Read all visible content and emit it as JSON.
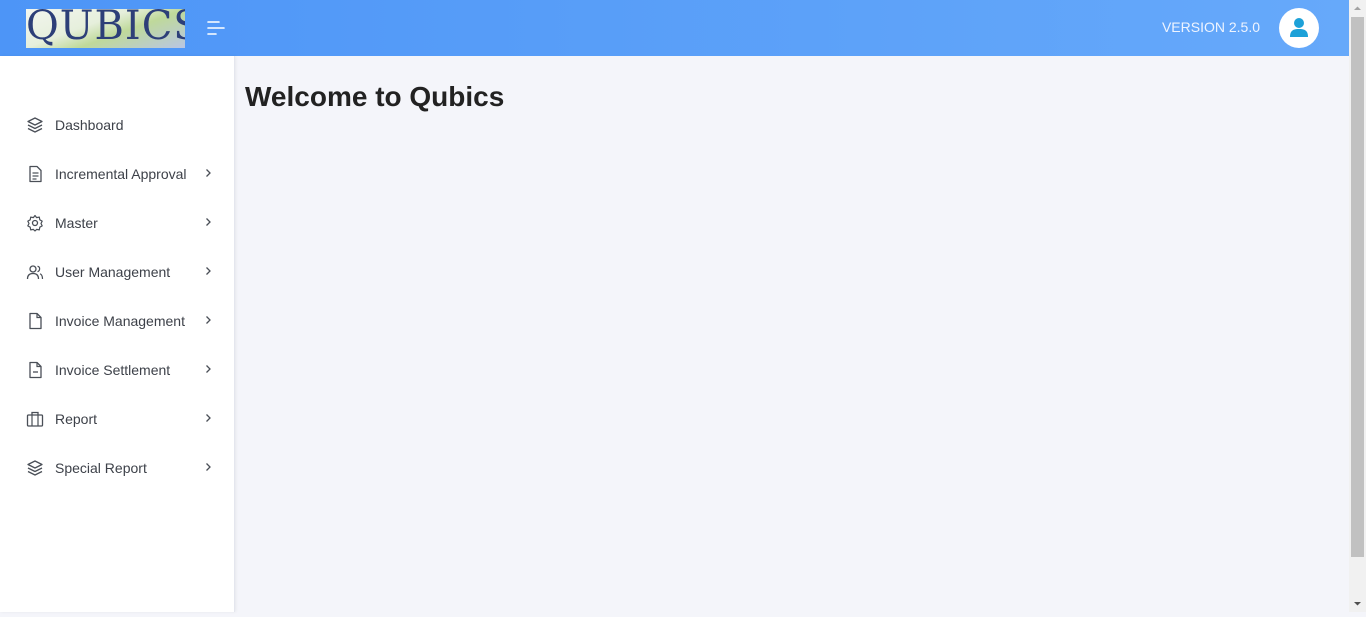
{
  "header": {
    "logo_text": "QUBICS",
    "version": "VERSION 2.5.0"
  },
  "sidebar": {
    "items": [
      {
        "label": "Dashboard",
        "icon": "layers-icon",
        "has_submenu": false
      },
      {
        "label": "Incremental Approval",
        "icon": "document-icon",
        "has_submenu": true
      },
      {
        "label": "Master",
        "icon": "gear-icon",
        "has_submenu": true
      },
      {
        "label": "User Management",
        "icon": "users-icon",
        "has_submenu": true
      },
      {
        "label": "Invoice Management",
        "icon": "file-icon",
        "has_submenu": true
      },
      {
        "label": "Invoice Settlement",
        "icon": "file-minus-icon",
        "has_submenu": true
      },
      {
        "label": "Report",
        "icon": "briefcase-icon",
        "has_submenu": true
      },
      {
        "label": "Special Report",
        "icon": "layers-icon",
        "has_submenu": true
      }
    ]
  },
  "main": {
    "title": "Welcome to Qubics"
  },
  "colors": {
    "header_start": "#4d95f7",
    "header_end": "#66a9fa",
    "avatar_icon": "#1da1d8",
    "page_background": "#f4f5fa"
  }
}
